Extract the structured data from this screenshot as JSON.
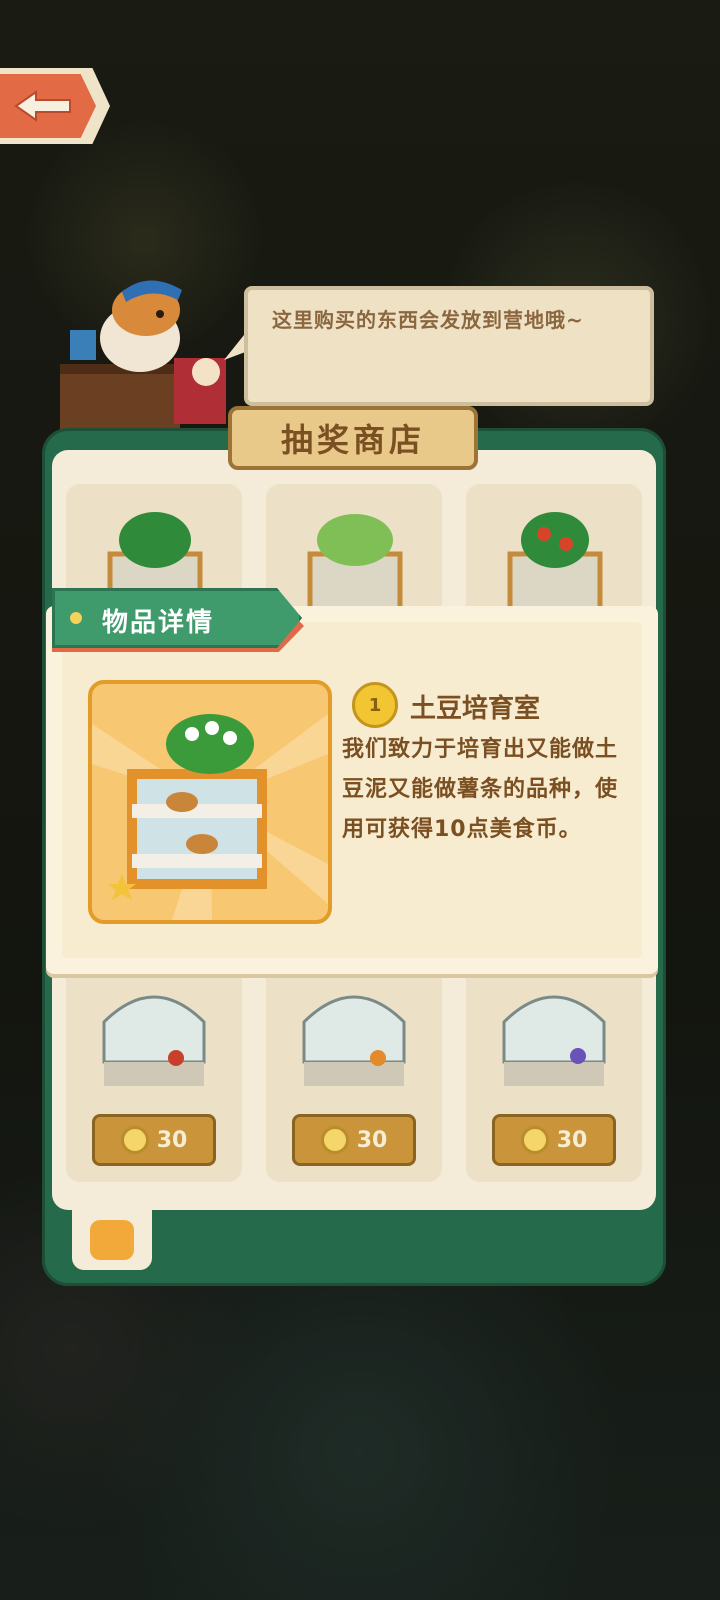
{
  "bubble": {
    "text": "这里购买的东西会发放到营地哦~"
  },
  "shop": {
    "title": "抽奖商店",
    "items": [
      {
        "price": "30"
      },
      {
        "price": "30"
      },
      {
        "price": "30"
      }
    ]
  },
  "detail": {
    "header": "物品详情",
    "rank": "1",
    "name": "土豆培育室",
    "description": "我们致力于培育出又能做土豆泥又能做薯条的品种，使用可获得10点美食币。"
  },
  "colors": {
    "panel_green": "#256a4a",
    "accent_orange": "#e26a44",
    "cream": "#f4ecd8"
  }
}
